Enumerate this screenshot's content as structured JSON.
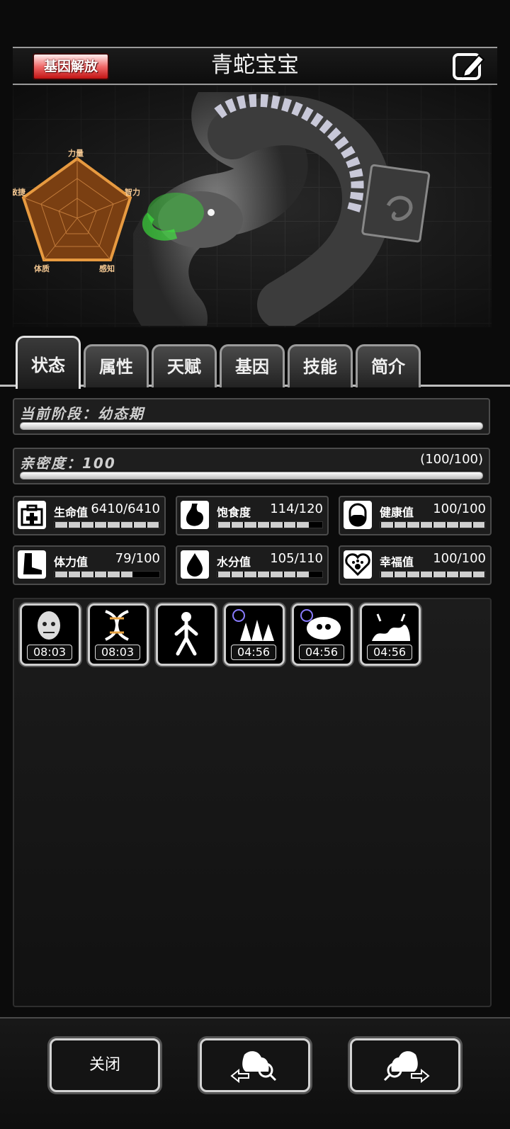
{
  "header": {
    "badge_label": "基因解放",
    "title": "青蛇宝宝",
    "edit_icon": "edit-icon"
  },
  "radar": {
    "labels": {
      "top": "力量",
      "right": "智力",
      "bottom_right": "感知",
      "bottom_left": "体质",
      "left": "敏捷"
    }
  },
  "tabs": [
    {
      "label": "状态",
      "active": true
    },
    {
      "label": "属性"
    },
    {
      "label": "天赋"
    },
    {
      "label": "基因"
    },
    {
      "label": "技能"
    },
    {
      "label": "简介"
    }
  ],
  "stage": {
    "label": "当前阶段：幼态期",
    "progress": 1.0
  },
  "intimacy": {
    "label": "亲密度：100",
    "value_text": "(100/100)",
    "progress": 1.0
  },
  "stats": [
    {
      "name": "生命值",
      "value": "6410/6410",
      "icon": "first-aid-icon",
      "filled": 8,
      "segments": 8
    },
    {
      "name": "饱食度",
      "value": "114/120",
      "icon": "stomach-icon",
      "filled": 7,
      "segments": 8
    },
    {
      "name": "健康值",
      "value": "100/100",
      "icon": "capsule-icon",
      "filled": 8,
      "segments": 8
    },
    {
      "name": "体力值",
      "value": "79/100",
      "icon": "foot-icon",
      "filled": 6,
      "segments": 8
    },
    {
      "name": "水分值",
      "value": "105/110",
      "icon": "water-drop-icon",
      "filled": 7,
      "segments": 8
    },
    {
      "name": "幸福值",
      "value": "100/100",
      "icon": "heart-paw-icon",
      "filled": 8,
      "segments": 8
    }
  ],
  "buffs": [
    {
      "icon": "bald-head-icon",
      "timer": "08:03"
    },
    {
      "icon": "dna-icon",
      "timer": "08:03"
    },
    {
      "icon": "walking-figure-icon",
      "timer": ""
    },
    {
      "icon": "spikes-icon",
      "timer": "04:56"
    },
    {
      "icon": "skull-cloud-icon",
      "timer": "04:56"
    },
    {
      "icon": "wave-icon",
      "timer": "04:56"
    }
  ],
  "footer": {
    "close_label": "关闭",
    "prev_icon": "prev-pet-icon",
    "next_icon": "next-pet-icon"
  }
}
